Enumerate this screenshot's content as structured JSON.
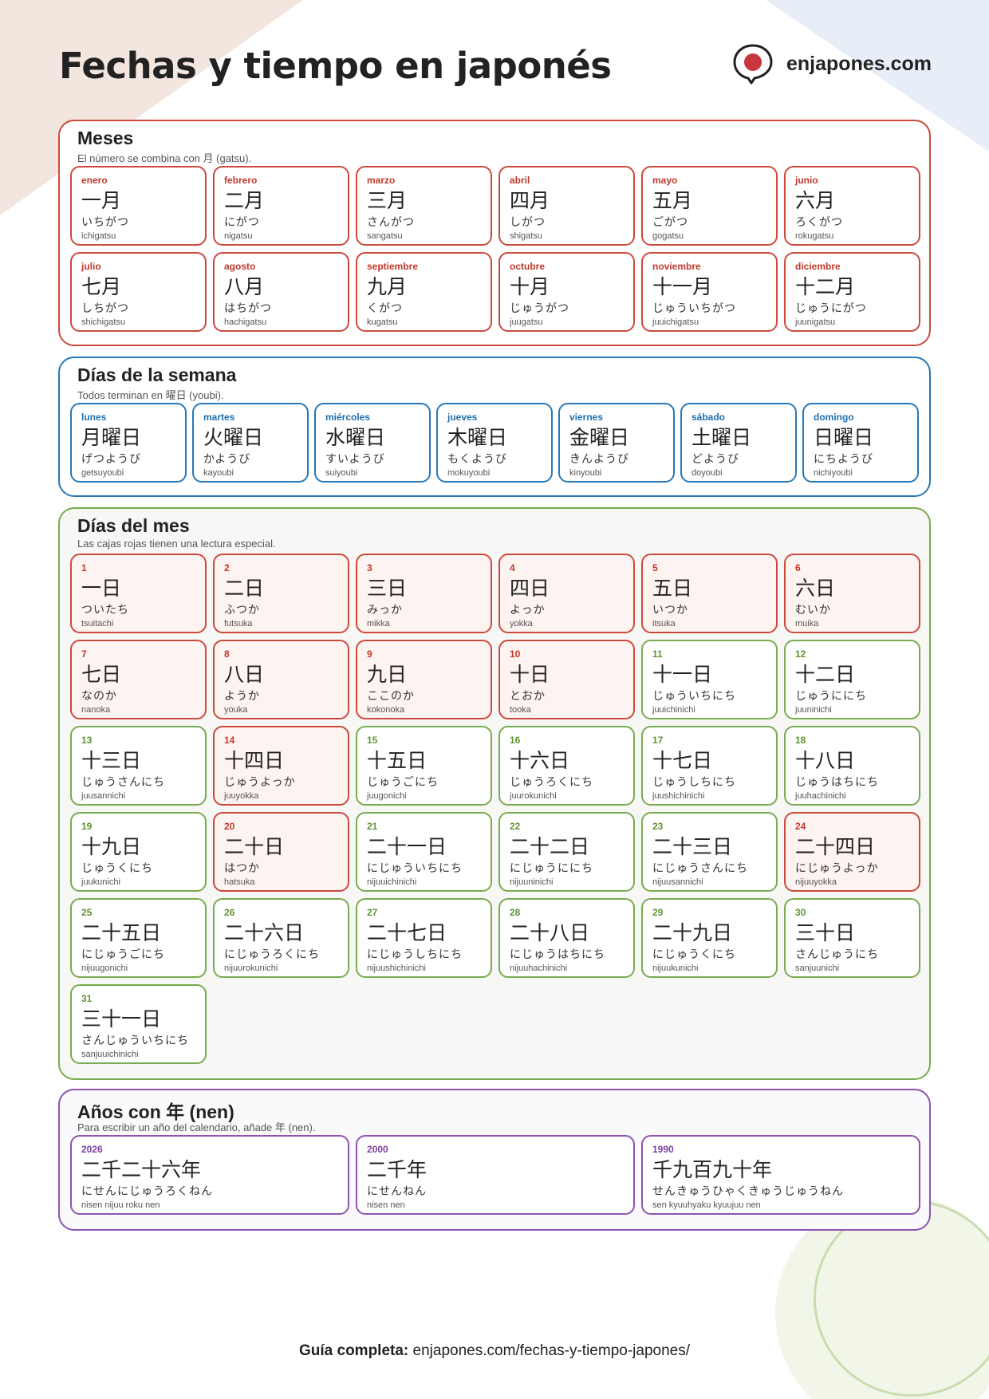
{
  "title": "Fechas y tiempo en japonés",
  "brand": {
    "name": "enjapones.com",
    "colors": {
      "accent_red": "#cc4a3c",
      "blue": "#2779b8",
      "green": "#7aab4e",
      "purple": "#8e54b0"
    }
  },
  "months": {
    "title": "Meses",
    "subtitle": "El número se combina con 月 (gatsu).",
    "items": [
      {
        "label": "enero",
        "kanji": "一月",
        "kana": "いちがつ",
        "romaji": "ichigatsu"
      },
      {
        "label": "febrero",
        "kanji": "二月",
        "kana": "にがつ",
        "romaji": "nigatsu"
      },
      {
        "label": "marzo",
        "kanji": "三月",
        "kana": "さんがつ",
        "romaji": "sangatsu"
      },
      {
        "label": "abril",
        "kanji": "四月",
        "kana": "しがつ",
        "romaji": "shigatsu"
      },
      {
        "label": "mayo",
        "kanji": "五月",
        "kana": "ごがつ",
        "romaji": "gogatsu"
      },
      {
        "label": "junio",
        "kanji": "六月",
        "kana": "ろくがつ",
        "romaji": "rokugatsu"
      },
      {
        "label": "julio",
        "kanji": "七月",
        "kana": "しちがつ",
        "romaji": "shichigatsu"
      },
      {
        "label": "agosto",
        "kanji": "八月",
        "kana": "はちがつ",
        "romaji": "hachigatsu"
      },
      {
        "label": "septiembre",
        "kanji": "九月",
        "kana": "くがつ",
        "romaji": "kugatsu"
      },
      {
        "label": "octubre",
        "kanji": "十月",
        "kana": "じゅうがつ",
        "romaji": "juugatsu"
      },
      {
        "label": "noviembre",
        "kanji": "十一月",
        "kana": "じゅういちがつ",
        "romaji": "juuichigatsu"
      },
      {
        "label": "diciembre",
        "kanji": "十二月",
        "kana": "じゅうにがつ",
        "romaji": "juunigatsu"
      }
    ]
  },
  "weekdays": {
    "title": "Días de la semana",
    "subtitle": "Todos terminan en 曜日 (youbi).",
    "items": [
      {
        "label": "lunes",
        "kanji": "月曜日",
        "kana": "げつようび",
        "romaji": "getsuyoubi"
      },
      {
        "label": "martes",
        "kanji": "火曜日",
        "kana": "かようび",
        "romaji": "kayoubi"
      },
      {
        "label": "miércoles",
        "kanji": "水曜日",
        "kana": "すいようび",
        "romaji": "suiyoubi"
      },
      {
        "label": "jueves",
        "kanji": "木曜日",
        "kana": "もくようび",
        "romaji": "mokuyoubi"
      },
      {
        "label": "viernes",
        "kanji": "金曜日",
        "kana": "きんようび",
        "romaji": "kinyoubi"
      },
      {
        "label": "sábado",
        "kanji": "土曜日",
        "kana": "どようび",
        "romaji": "doyoubi"
      },
      {
        "label": "domingo",
        "kanji": "日曜日",
        "kana": "にちようび",
        "romaji": "nichiyoubi"
      }
    ]
  },
  "days": {
    "title": "Días del mes",
    "subtitle": "Las cajas rojas tienen una lectura especial.",
    "items": [
      {
        "label": "1",
        "kanji": "一日",
        "kana": "ついたち",
        "romaji": "tsuitachi",
        "special": true
      },
      {
        "label": "2",
        "kanji": "二日",
        "kana": "ふつか",
        "romaji": "futsuka",
        "special": true
      },
      {
        "label": "3",
        "kanji": "三日",
        "kana": "みっか",
        "romaji": "mikka",
        "special": true
      },
      {
        "label": "4",
        "kanji": "四日",
        "kana": "よっか",
        "romaji": "yokka",
        "special": true
      },
      {
        "label": "5",
        "kanji": "五日",
        "kana": "いつか",
        "romaji": "itsuka",
        "special": true
      },
      {
        "label": "6",
        "kanji": "六日",
        "kana": "むいか",
        "romaji": "muika",
        "special": true
      },
      {
        "label": "7",
        "kanji": "七日",
        "kana": "なのか",
        "romaji": "nanoka",
        "special": true
      },
      {
        "label": "8",
        "kanji": "八日",
        "kana": "ようか",
        "romaji": "youka",
        "special": true
      },
      {
        "label": "9",
        "kanji": "九日",
        "kana": "ここのか",
        "romaji": "kokonoka",
        "special": true
      },
      {
        "label": "10",
        "kanji": "十日",
        "kana": "とおか",
        "romaji": "tooka",
        "special": true
      },
      {
        "label": "11",
        "kanji": "十一日",
        "kana": "じゅういちにち",
        "romaji": "juuichinichi",
        "special": false
      },
      {
        "label": "12",
        "kanji": "十二日",
        "kana": "じゅうににち",
        "romaji": "juuninichi",
        "special": false
      },
      {
        "label": "13",
        "kanji": "十三日",
        "kana": "じゅうさんにち",
        "romaji": "juusannichi",
        "special": false
      },
      {
        "label": "14",
        "kanji": "十四日",
        "kana": "じゅうよっか",
        "romaji": "juuyokka",
        "special": true
      },
      {
        "label": "15",
        "kanji": "十五日",
        "kana": "じゅうごにち",
        "romaji": "juugonichi",
        "special": false
      },
      {
        "label": "16",
        "kanji": "十六日",
        "kana": "じゅうろくにち",
        "romaji": "juurokunichi",
        "special": false
      },
      {
        "label": "17",
        "kanji": "十七日",
        "kana": "じゅうしちにち",
        "romaji": "juushichinichi",
        "special": false
      },
      {
        "label": "18",
        "kanji": "十八日",
        "kana": "じゅうはちにち",
        "romaji": "juuhachinichi",
        "special": false
      },
      {
        "label": "19",
        "kanji": "十九日",
        "kana": "じゅうくにち",
        "romaji": "juukunichi",
        "special": false
      },
      {
        "label": "20",
        "kanji": "二十日",
        "kana": "はつか",
        "romaji": "hatsuka",
        "special": true
      },
      {
        "label": "21",
        "kanji": "二十一日",
        "kana": "にじゅういちにち",
        "romaji": "nijuuichinichi",
        "special": false
      },
      {
        "label": "22",
        "kanji": "二十二日",
        "kana": "にじゅうににち",
        "romaji": "nijuuninichi",
        "special": false
      },
      {
        "label": "23",
        "kanji": "二十三日",
        "kana": "にじゅうさんにち",
        "romaji": "nijuusannichi",
        "special": false
      },
      {
        "label": "24",
        "kanji": "二十四日",
        "kana": "にじゅうよっか",
        "romaji": "nijuuyokka",
        "special": true
      },
      {
        "label": "25",
        "kanji": "二十五日",
        "kana": "にじゅうごにち",
        "romaji": "nijuugonichi",
        "special": false
      },
      {
        "label": "26",
        "kanji": "二十六日",
        "kana": "にじゅうろくにち",
        "romaji": "nijuurokunichi",
        "special": false
      },
      {
        "label": "27",
        "kanji": "二十七日",
        "kana": "にじゅうしちにち",
        "romaji": "nijuushichinichi",
        "special": false
      },
      {
        "label": "28",
        "kanji": "二十八日",
        "kana": "にじゅうはちにち",
        "romaji": "nijuuhachinichi",
        "special": false
      },
      {
        "label": "29",
        "kanji": "二十九日",
        "kana": "にじゅうくにち",
        "romaji": "nijuukunichi",
        "special": false
      },
      {
        "label": "30",
        "kanji": "三十日",
        "kana": "さんじゅうにち",
        "romaji": "sanjuunichi",
        "special": false
      },
      {
        "label": "31",
        "kanji": "三十一日",
        "kana": "さんじゅういちにち",
        "romaji": "sanjuuichinichi",
        "special": false
      }
    ]
  },
  "years": {
    "title": "Años con 年 (nen)",
    "subtitle": "Para escribir un año del calendario, añade 年 (nen).",
    "items": [
      {
        "label": "2026",
        "kanji": "二千二十六年",
        "kana": "にせんにじゅうろくねん",
        "romaji": "nisen nijuu roku nen"
      },
      {
        "label": "2000",
        "kanji": "二千年",
        "kana": "にせんねん",
        "romaji": "nisen nen"
      },
      {
        "label": "1990",
        "kanji": "千九百九十年",
        "kana": "せんきゅうひゃくきゅうじゅうねん",
        "romaji": "sen kyuuhyaku kyuujuu nen"
      }
    ]
  },
  "footer": {
    "label": "Guía completa:",
    "url": "enjapones.com/fechas-y-tiempo-japones/"
  }
}
